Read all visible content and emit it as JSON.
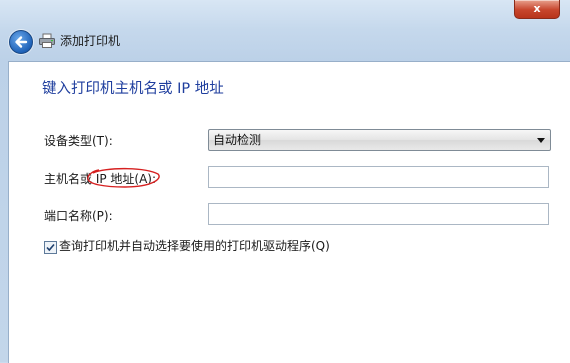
{
  "window": {
    "title": "添加打印机",
    "close_label": "x"
  },
  "main": {
    "heading": "键入打印机主机名或 IP 地址",
    "device_type": {
      "label": "设备类型(T):",
      "value": "自动检测"
    },
    "hostname": {
      "label": "主机名或 IP 地址(A):",
      "value": ""
    },
    "port_name": {
      "label": "端口名称(P):",
      "value": ""
    },
    "query_checkbox": {
      "label": "查询打印机并自动选择要使用的打印机驱动程序(Q)",
      "checked": true
    }
  },
  "colors": {
    "heading": "#1f3e9e",
    "annotation": "#d62020",
    "close_button": "#c7452c"
  },
  "icons": [
    "back-arrow-icon",
    "printer-icon",
    "chevron-down-icon",
    "checkmark-icon"
  ]
}
